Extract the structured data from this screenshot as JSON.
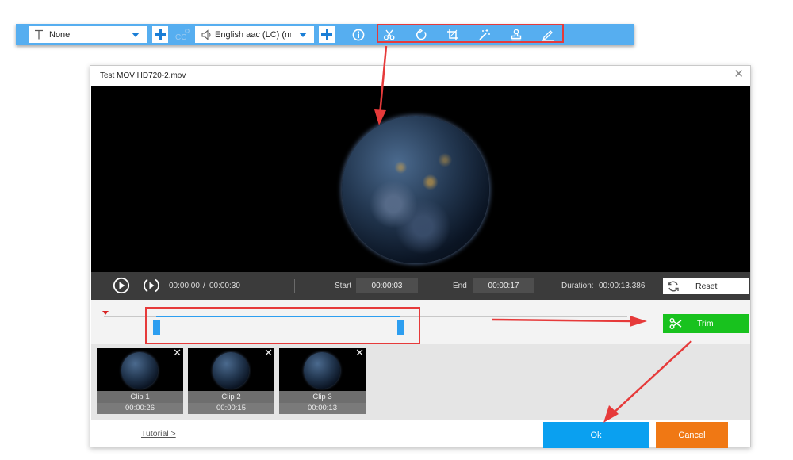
{
  "toolbar": {
    "subtitle_value": "None",
    "audio_value": "English aac (LC) (mp",
    "icons": [
      "subtitle-text-icon",
      "add-subtitle-icon",
      "closed-caption-icon",
      "speaker-icon",
      "add-audio-icon",
      "info-icon",
      "scissors-icon",
      "rotate-icon",
      "crop-icon",
      "effects-wand-icon",
      "watermark-stamp-icon",
      "edit-pen-icon"
    ]
  },
  "dialog": {
    "title": "Test MOV HD720-2.mov",
    "close_glyph": "✕"
  },
  "player": {
    "current_time": "00:00:00",
    "separator": "/",
    "total_time": "00:00:30",
    "start_label": "Start",
    "start_value": "00:00:03",
    "end_label": "End",
    "end_value": "00:00:17",
    "duration_label": "Duration:",
    "duration_value": "00:00:13.386",
    "reset_label": "Reset"
  },
  "timeline": {
    "selection_start_fraction": 0.1,
    "selection_end_fraction": 0.567,
    "trim_label": "Trim"
  },
  "clips": [
    {
      "label": "Clip 1",
      "time": "00:00:26"
    },
    {
      "label": "Clip 2",
      "time": "00:00:15"
    },
    {
      "label": "Clip 3",
      "time": "00:00:13"
    }
  ],
  "footer": {
    "tutorial_label": "Tutorial >",
    "ok_label": "Ok",
    "cancel_label": "Cancel"
  },
  "colors": {
    "toolbar_bg": "#56aef0",
    "accent_blue": "#0aa0f0",
    "trim_green": "#18c21e",
    "cancel_orange": "#f07814",
    "annotation_red": "#e63a3a"
  }
}
